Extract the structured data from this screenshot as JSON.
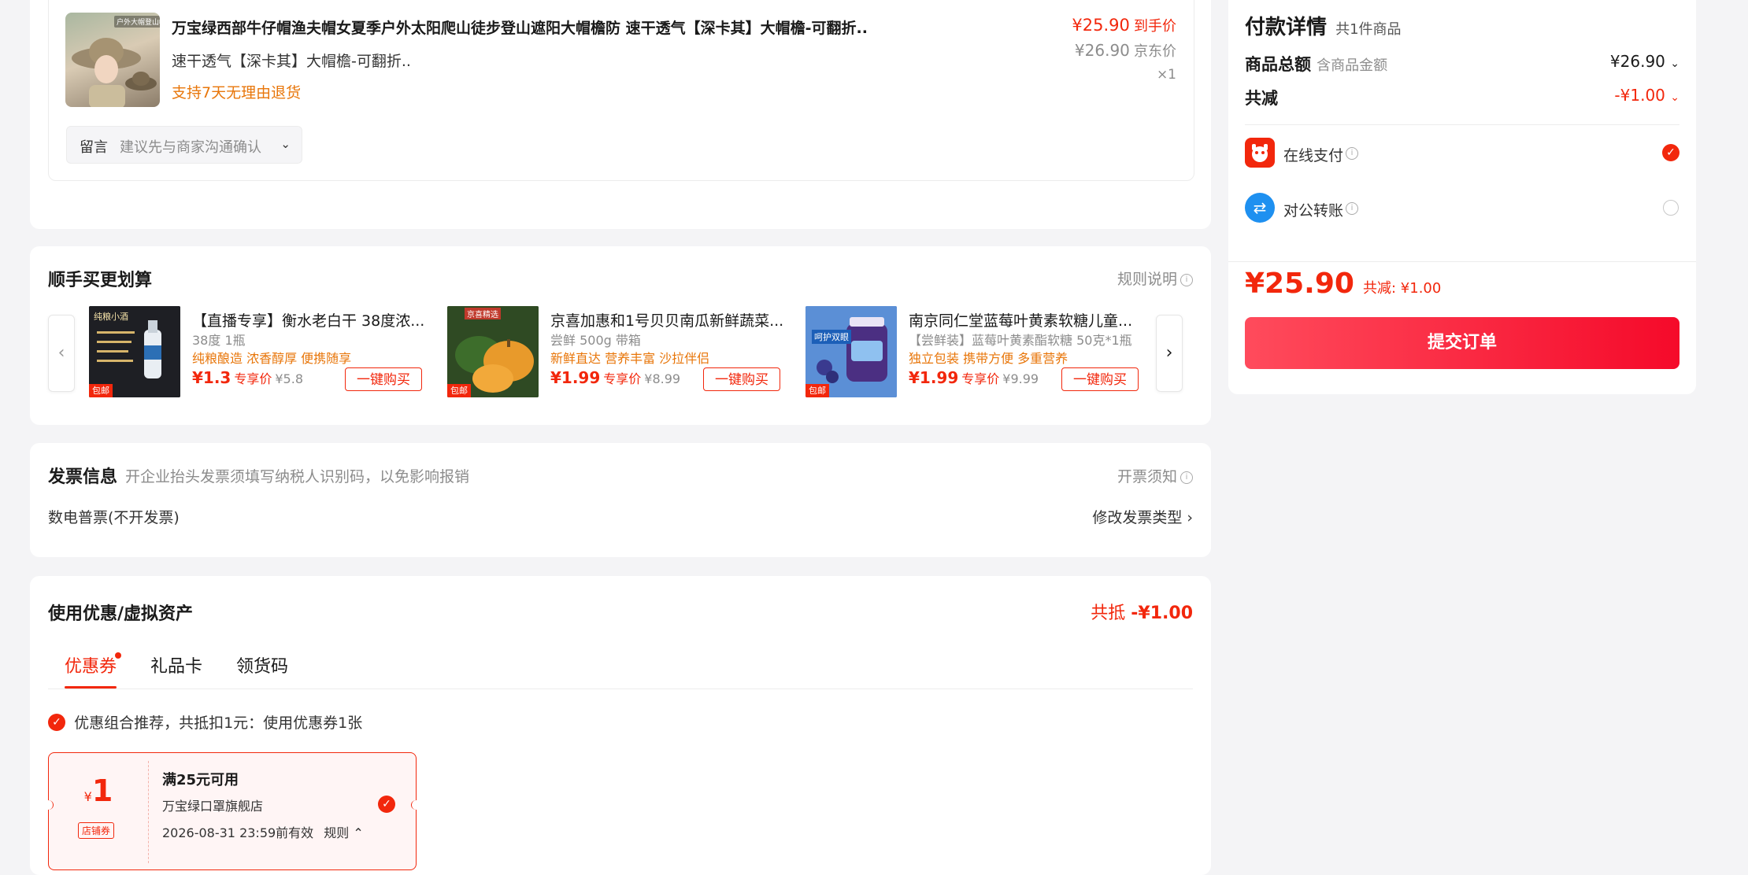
{
  "product": {
    "title": "万宝绿西部牛仔帽渔夫帽女夏季户外太阳爬山徒步登山遮阳大帽檐防 速干透气【深卡其】大帽檐-可翻折..",
    "variant": "速干透气【深卡其】大帽檐-可翻折..",
    "return_policy": "支持7天无理由退货",
    "price": "¥25.90",
    "price_label": "到手价",
    "jd_price": "¥26.90",
    "jd_price_label": "京东价",
    "quantity": "×1",
    "thumb_text": "户外大帽登山帽",
    "note_label": "留言",
    "note_placeholder": "建议先与商家沟通确认"
  },
  "addon": {
    "title": "顺手买更划算",
    "rules_link": "规则说明",
    "items": [
      {
        "title": "【直播专享】衡水老白干 38度浓...",
        "spec": "38度 1瓶",
        "tags": "纯粮酿造 浓香醇厚 便携随享",
        "price": "¥1.3",
        "price_label": "专享价",
        "orig_price": "¥5.8",
        "button": "一键购买",
        "badge": "包邮",
        "img_text": "纯粮小酒"
      },
      {
        "title": "京喜加惠和1号贝贝南瓜新鲜蔬菜...",
        "spec": "尝鲜 500g 带箱",
        "tags": "新鲜直达 营养丰富 沙拉伴侣",
        "price": "¥1.99",
        "price_label": "专享价",
        "orig_price": "¥8.99",
        "button": "一键购买",
        "badge": "包邮",
        "img_text": "京喜精选"
      },
      {
        "title": "南京同仁堂蓝莓叶黄素软糖儿童...",
        "spec": "【尝鲜装】蓝莓叶黄素酯软糖 50克*1瓶",
        "tags": "独立包装 携带方便 多重营养",
        "price": "¥1.99",
        "price_label": "专享价",
        "orig_price": "¥9.99",
        "button": "一键购买",
        "badge": "包邮",
        "img_text": "呵护双眼"
      }
    ]
  },
  "invoice": {
    "title": "发票信息",
    "hint": "开企业抬头发票须填写纳税人识别码，以免影响报销",
    "notice_link": "开票须知",
    "current": "数电普票(不开发票)",
    "modify_link": "修改发票类型"
  },
  "coupons": {
    "title": "使用优惠/虚拟资产",
    "total_label": "共抵",
    "total_value": "-¥1.00",
    "tabs": [
      "优惠券",
      "礼品卡",
      "领货码"
    ],
    "recommend_text": "优惠组合推荐，共抵扣1元：使用优惠券1张",
    "coupon": {
      "currency": "¥",
      "amount": "1",
      "type": "店铺券",
      "condition": "满25元可用",
      "shop": "万宝绿口罩旗舰店",
      "expiry": "2026-08-31 23:59前有效",
      "rules": "规则"
    }
  },
  "payment": {
    "title": "付款详情",
    "count": "共1件商品",
    "goods_total_label": "商品总额",
    "goods_total_sub": "含商品金额",
    "goods_total_value": "¥26.90",
    "discount_label": "共减",
    "discount_value": "-¥1.00",
    "methods": [
      {
        "label": "在线支付",
        "selected": true
      },
      {
        "label": "对公转账",
        "selected": false
      }
    ],
    "final_price": "¥25.90",
    "final_discount": "共减: ¥1.00",
    "submit_label": "提交订单"
  },
  "colors": {
    "accent": "#f2270c",
    "orange": "#e8760a",
    "page_bg": "#f4f4f6"
  }
}
